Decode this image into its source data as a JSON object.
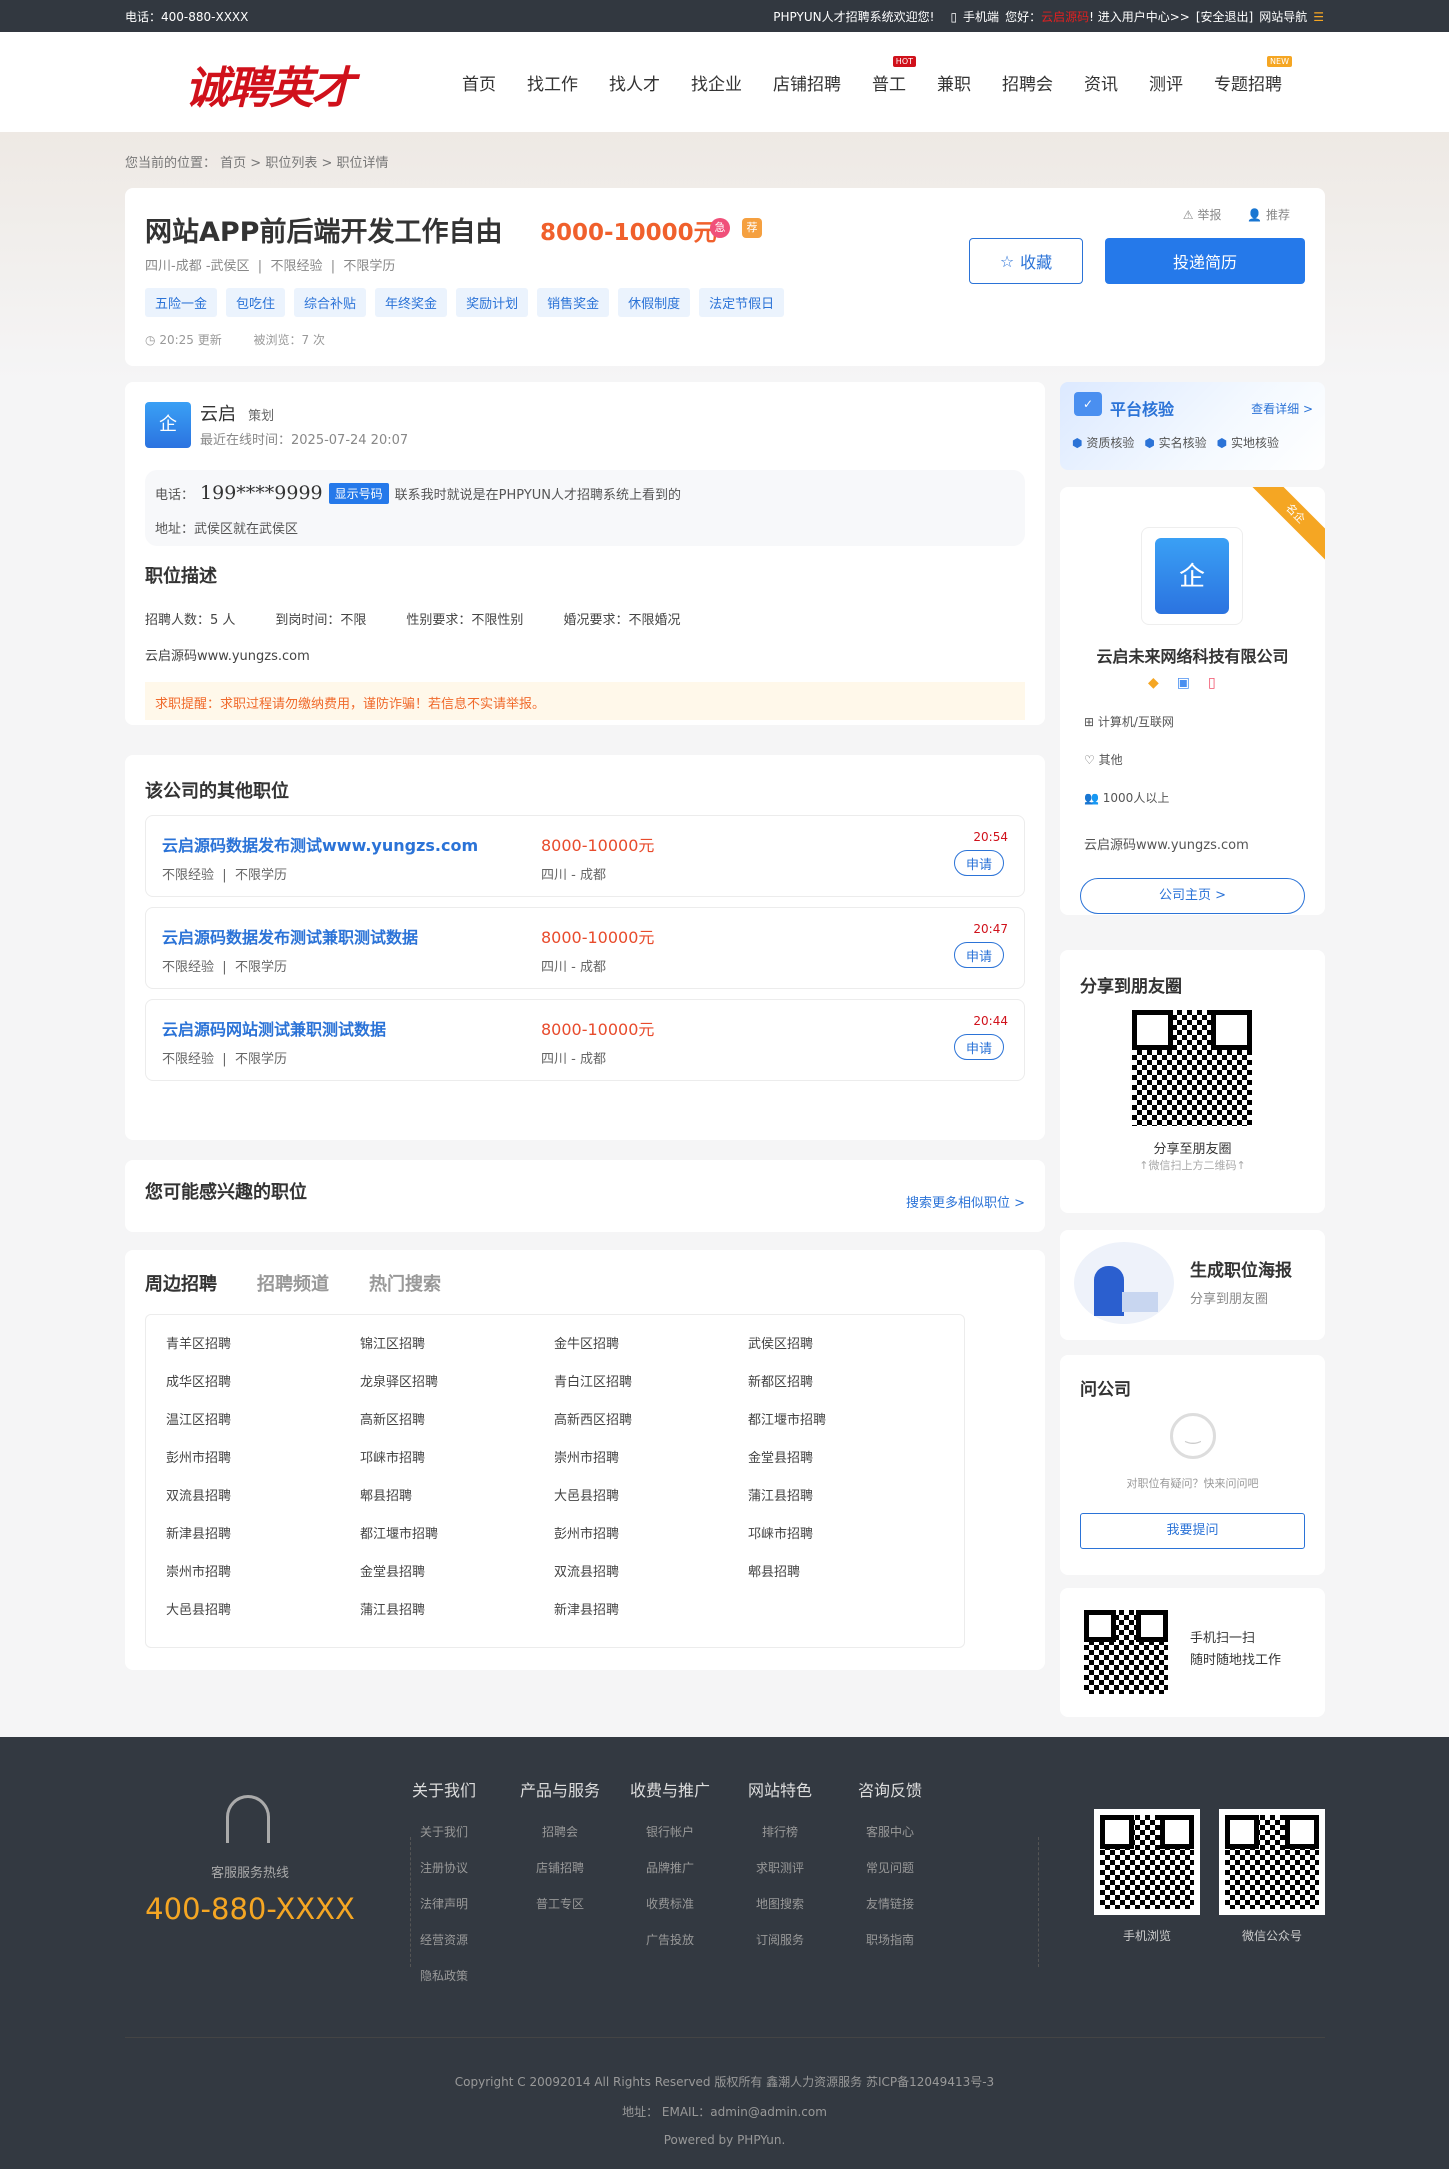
{
  "topbar": {
    "phone": "电话：400-880-XXXX",
    "welcome": "PHPYUN人才招聘系统欢迎您!",
    "mobile": "手机端",
    "hello": "您好：",
    "username": "云启源码",
    "user_center": "! 进入用户中心>>",
    "logout": "[安全退出]",
    "site_nav": "网站导航"
  },
  "header": {
    "logo": "诚聘英才",
    "nav": [
      "首页",
      "找工作",
      "找人才",
      "找企业",
      "店铺招聘",
      "普工",
      "兼职",
      "招聘会",
      "资讯",
      "测评",
      "专题招聘"
    ],
    "hot_badge": "HOT",
    "new_badge": "NEW"
  },
  "breadcrumb": {
    "label": "您当前的位置：",
    "items": [
      "首页",
      "职位列表",
      "职位详情"
    ],
    "sep": " > "
  },
  "job": {
    "title": "网站APP前后端开发工作自由",
    "salary": "8000-10000元",
    "urgent_icon": "急",
    "rec_icon": "荐",
    "location": "四川-成都 -武侯区",
    "experience": "不限经验",
    "education": "不限学历",
    "tags": [
      "五险一金",
      "包吃住",
      "综合补贴",
      "年终奖金",
      "奖励计划",
      "销售奖金",
      "休假制度",
      "法定节假日"
    ],
    "updated": "20:25 更新",
    "views": "被浏览：7 次",
    "report": "举报",
    "recommend": "推荐",
    "favorite": "收藏",
    "apply": "投递简历"
  },
  "contact": {
    "name": "云启",
    "role": "策划",
    "online": "最近在线时间：2025-07-24 20:07",
    "phone_label": "电话：",
    "phone": "199****9999",
    "show_number": "显示号码",
    "phone_note": "联系我时就说是在PHPYUN人才招聘系统上看到的",
    "address": "地址：武侯区就在武侯区"
  },
  "description": {
    "title": "职位描述",
    "fields": [
      "招聘人数：5 人",
      "到岗时间：不限",
      "性别要求：不限性别",
      "婚况要求：不限婚况"
    ],
    "content": "云启源码www.yungzs.com",
    "warning": "求职提醒：求职过程请勿缴纳费用，谨防诈骗！若信息不实请举报。"
  },
  "other_jobs": {
    "title": "该公司的其他职位",
    "apply": "申请",
    "items": [
      {
        "title": "云启源码数据发布测试www.yungzs.com",
        "salary": "8000-10000元",
        "experience": "不限经验",
        "education": "不限学历",
        "location": "四川 - 成都",
        "time": "20:54"
      },
      {
        "title": "云启源码数据发布测试兼职测试数据",
        "salary": "8000-10000元",
        "experience": "不限经验",
        "education": "不限学历",
        "location": "四川 - 成都",
        "time": "20:47"
      },
      {
        "title": "云启源码网站测试兼职测试数据",
        "salary": "8000-10000元",
        "experience": "不限经验",
        "education": "不限学历",
        "location": "四川 - 成都",
        "time": "20:44"
      }
    ]
  },
  "interest": {
    "title": "您可能感兴趣的职位",
    "more": "搜索更多相似职位 >"
  },
  "nearby": {
    "tabs": [
      "周边招聘",
      "招聘频道",
      "热门搜索"
    ],
    "links": [
      "青羊区招聘",
      "锦江区招聘",
      "金牛区招聘",
      "武侯区招聘",
      "成华区招聘",
      "龙泉驿区招聘",
      "青白江区招聘",
      "新都区招聘",
      "温江区招聘",
      "高新区招聘",
      "高新西区招聘",
      "都江堰市招聘",
      "彭州市招聘",
      "邛崃市招聘",
      "崇州市招聘",
      "金堂县招聘",
      "双流县招聘",
      "郫县招聘",
      "大邑县招聘",
      "蒲江县招聘",
      "新津县招聘",
      "都江堰市招聘",
      "彭州市招聘",
      "邛崃市招聘",
      "崇州市招聘",
      "金堂县招聘",
      "双流县招聘",
      "郫县招聘",
      "大邑县招聘",
      "蒲江县招聘",
      "新津县招聘"
    ]
  },
  "verify": {
    "title": "平台核验",
    "detail": "查看详细 >",
    "items": [
      "资质核验",
      "实名核验",
      "实地核验"
    ]
  },
  "company": {
    "ribbon": "名企",
    "logo_char": "企",
    "name": "云启未来网络科技有限公司",
    "industry": "计算机/互联网",
    "type": "其他",
    "size": "1000人以上",
    "desc": "云启源码www.yungzs.com",
    "home": "公司主页 >"
  },
  "share": {
    "title": "分享到朋友圈",
    "caption": "分享至朋友圈",
    "hint": "↑微信扫上方二维码↑"
  },
  "poster": {
    "title": "生成职位海报",
    "sub": "分享到朋友圈"
  },
  "ask": {
    "title": "问公司",
    "hint": "对职位有疑问？快来问问吧",
    "button": "我要提问"
  },
  "app": {
    "line1": "手机扫一扫",
    "line2": "随时随地找工作"
  },
  "footer": {
    "hotline_label": "客服服务热线",
    "hotline": "400-880-XXXX",
    "columns": [
      {
        "title": "关于我们",
        "items": [
          "关于我们",
          "注册协议",
          "法律声明",
          "经营资源",
          "隐私政策"
        ]
      },
      {
        "title": "产品与服务",
        "items": [
          "招聘会",
          "店铺招聘",
          "普工专区"
        ]
      },
      {
        "title": "收费与推广",
        "items": [
          "银行帐户",
          "品牌推广",
          "收费标准",
          "广告投放"
        ]
      },
      {
        "title": "网站特色",
        "items": [
          "排行榜",
          "求职测评",
          "地图搜索",
          "订阅服务"
        ]
      },
      {
        "title": "咨询反馈",
        "items": [
          "客服中心",
          "常见问题",
          "友情链接",
          "职场指南"
        ]
      }
    ],
    "qr1": "手机浏览",
    "qr2": "微信公众号",
    "copyright": "Copyright C 20092014 All Rights Reserved 版权所有 鑫潮人力资源服务 苏ICP备12049413号-3",
    "contact": "地址： EMAIL：admin@admin.com",
    "powered": "Powered by PHPYun."
  },
  "colors": {
    "primary": "#2579ea",
    "salary": "#f0602c",
    "topbar": "#323840",
    "footer": "#333941",
    "hotline": "#f5a623"
  }
}
